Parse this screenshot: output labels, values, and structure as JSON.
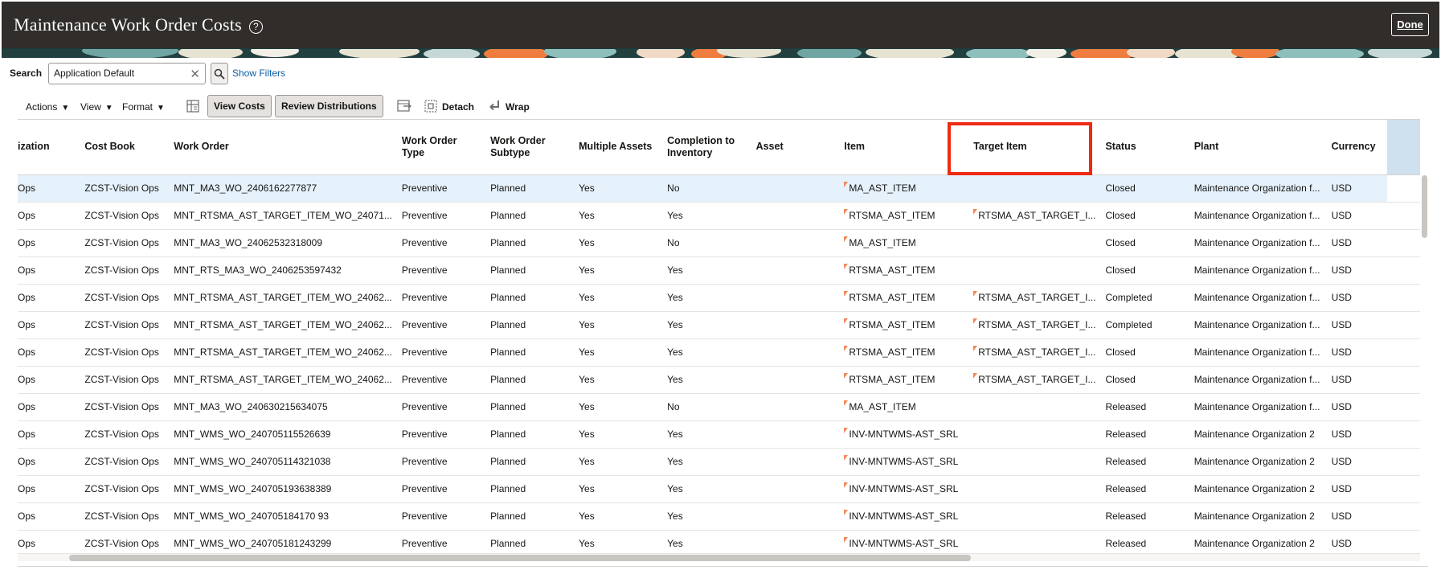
{
  "header": {
    "title": "Maintenance Work Order Costs",
    "help_glyph": "?",
    "done_label": "Done"
  },
  "search": {
    "label": "Search",
    "value": "Application Default",
    "show_filters": "Show Filters"
  },
  "toolbar": {
    "actions": "Actions",
    "view": "View",
    "format": "Format",
    "view_costs": "View Costs",
    "review_distributions": "Review Distributions",
    "detach": "Detach",
    "wrap": "Wrap"
  },
  "table": {
    "columns": [
      "ization",
      "Cost Book",
      "Work Order",
      "Work Order Type",
      "Work Order Subtype",
      "Multiple Assets",
      "Completion to Inventory",
      "Asset",
      "Item",
      "Target Item",
      "Status",
      "Plant",
      "Currency"
    ],
    "rows": [
      [
        "Ops",
        "ZCST-Vision Ops",
        "MNT_MA3_WO_2406162277877",
        "Preventive",
        "Planned",
        "Yes",
        "No",
        "",
        "MA_AST_ITEM",
        "",
        "Closed",
        "Maintenance Organization f...",
        "USD"
      ],
      [
        "Ops",
        "ZCST-Vision Ops",
        "MNT_RTSMA_AST_TARGET_ITEM_WO_24071...",
        "Preventive",
        "Planned",
        "Yes",
        "Yes",
        "",
        "RTSMA_AST_ITEM",
        "RTSMA_AST_TARGET_I...",
        "Closed",
        "Maintenance Organization f...",
        "USD"
      ],
      [
        "Ops",
        "ZCST-Vision Ops",
        "MNT_MA3_WO_24062532318009",
        "Preventive",
        "Planned",
        "Yes",
        "No",
        "",
        "MA_AST_ITEM",
        "",
        "Closed",
        "Maintenance Organization f...",
        "USD"
      ],
      [
        "Ops",
        "ZCST-Vision Ops",
        "MNT_RTS_MA3_WO_2406253597432",
        "Preventive",
        "Planned",
        "Yes",
        "Yes",
        "",
        "RTSMA_AST_ITEM",
        "",
        "Closed",
        "Maintenance Organization f...",
        "USD"
      ],
      [
        "Ops",
        "ZCST-Vision Ops",
        "MNT_RTSMA_AST_TARGET_ITEM_WO_24062...",
        "Preventive",
        "Planned",
        "Yes",
        "Yes",
        "",
        "RTSMA_AST_ITEM",
        "RTSMA_AST_TARGET_I...",
        "Completed",
        "Maintenance Organization f...",
        "USD"
      ],
      [
        "Ops",
        "ZCST-Vision Ops",
        "MNT_RTSMA_AST_TARGET_ITEM_WO_24062...",
        "Preventive",
        "Planned",
        "Yes",
        "Yes",
        "",
        "RTSMA_AST_ITEM",
        "RTSMA_AST_TARGET_I...",
        "Completed",
        "Maintenance Organization f...",
        "USD"
      ],
      [
        "Ops",
        "ZCST-Vision Ops",
        "MNT_RTSMA_AST_TARGET_ITEM_WO_24062...",
        "Preventive",
        "Planned",
        "Yes",
        "Yes",
        "",
        "RTSMA_AST_ITEM",
        "RTSMA_AST_TARGET_I...",
        "Closed",
        "Maintenance Organization f...",
        "USD"
      ],
      [
        "Ops",
        "ZCST-Vision Ops",
        "MNT_RTSMA_AST_TARGET_ITEM_WO_24062...",
        "Preventive",
        "Planned",
        "Yes",
        "Yes",
        "",
        "RTSMA_AST_ITEM",
        "RTSMA_AST_TARGET_I...",
        "Closed",
        "Maintenance Organization f...",
        "USD"
      ],
      [
        "Ops",
        "ZCST-Vision Ops",
        "MNT_MA3_WO_240630215634075",
        "Preventive",
        "Planned",
        "Yes",
        "No",
        "",
        "MA_AST_ITEM",
        "",
        "Released",
        "Maintenance Organization f...",
        "USD"
      ],
      [
        "Ops",
        "ZCST-Vision Ops",
        "MNT_WMS_WO_240705115526639",
        "Preventive",
        "Planned",
        "Yes",
        "Yes",
        "",
        "INV-MNTWMS-AST_SRL",
        "",
        "Released",
        "Maintenance Organization 2",
        "USD"
      ],
      [
        "Ops",
        "ZCST-Vision Ops",
        "MNT_WMS_WO_240705114321038",
        "Preventive",
        "Planned",
        "Yes",
        "Yes",
        "",
        "INV-MNTWMS-AST_SRL",
        "",
        "Released",
        "Maintenance Organization 2",
        "USD"
      ],
      [
        "Ops",
        "ZCST-Vision Ops",
        "MNT_WMS_WO_240705193638389",
        "Preventive",
        "Planned",
        "Yes",
        "Yes",
        "",
        "INV-MNTWMS-AST_SRL",
        "",
        "Released",
        "Maintenance Organization 2",
        "USD"
      ],
      [
        "Ops",
        "ZCST-Vision Ops",
        "MNT_WMS_WO_240705184170 93",
        "Preventive",
        "Planned",
        "Yes",
        "Yes",
        "",
        "INV-MNTWMS-AST_SRL",
        "",
        "Released",
        "Maintenance Organization 2",
        "USD"
      ],
      [
        "Ops",
        "ZCST-Vision Ops",
        "MNT_WMS_WO_240705181243299",
        "Preventive",
        "Planned",
        "Yes",
        "Yes",
        "",
        "INV-MNTWMS-AST_SRL",
        "",
        "Released",
        "Maintenance Organization 2",
        "USD"
      ]
    ]
  },
  "colors": {
    "header_bg": "#312d2a",
    "link": "#0b5ea3",
    "selected_row": "#e5f1fb",
    "highlight": "#ee2a12",
    "flag": "#f08a5d"
  },
  "icons": [
    "help-icon",
    "clear-icon",
    "search-icon",
    "caret-down-icon",
    "freeze-icon",
    "export-icon",
    "detach-icon",
    "wrap-icon",
    "flag-icon"
  ]
}
